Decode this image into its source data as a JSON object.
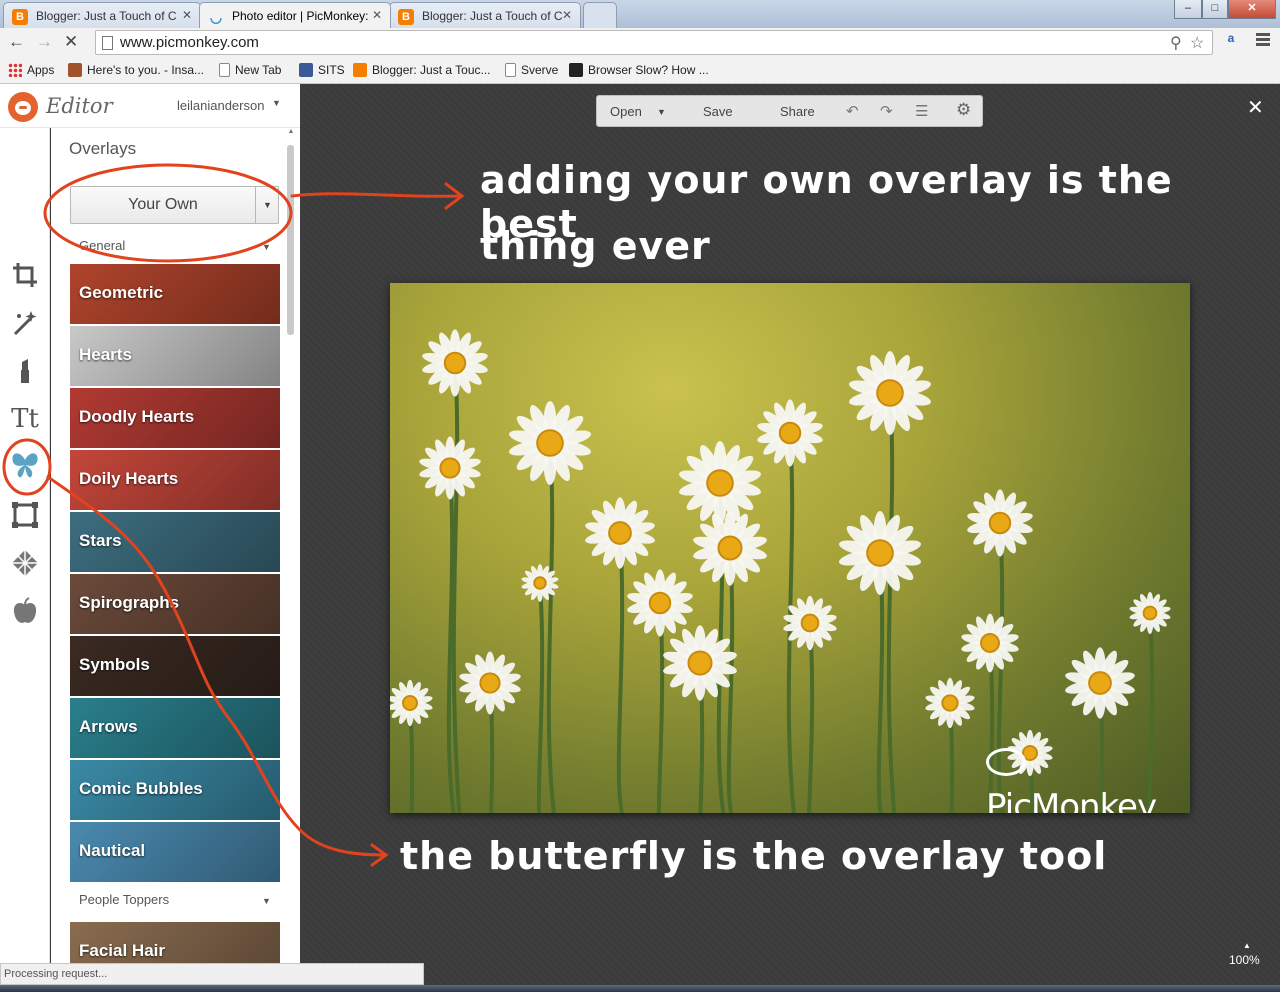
{
  "browser": {
    "tabs": [
      {
        "title": "Blogger: Just a Touch of C",
        "active": false,
        "favicon": "blogger-icon"
      },
      {
        "title": "Photo editor | PicMonkey:",
        "active": true,
        "favicon": "picmonkey-icon"
      },
      {
        "title": "Blogger: Just a Touch of C",
        "active": false,
        "favicon": "blogger-icon"
      }
    ],
    "window_controls": {
      "minimize": "–",
      "restore": "□",
      "close": "✕"
    },
    "url": "www.picmonkey.com",
    "bookmarks": [
      {
        "label": "Apps",
        "icon": "apps-grid-icon"
      },
      {
        "label": "Here's to you. - Insa...",
        "icon": "photo-favicon"
      },
      {
        "label": "New Tab",
        "icon": "page-icon"
      },
      {
        "label": "SITS",
        "icon": "facebook-icon"
      },
      {
        "label": "Blogger: Just a Touc...",
        "icon": "blogger-icon"
      },
      {
        "label": "Sverve",
        "icon": "page-icon"
      },
      {
        "label": "Browser Slow? How ...",
        "icon": "htg-icon"
      }
    ],
    "status_text": "Processing request..."
  },
  "editor": {
    "logo_text": "Editor",
    "username": "leilanianderson"
  },
  "panel": {
    "title": "Overlays",
    "your_own_button": "Your Own",
    "section_general": "General",
    "section_people": "People Toppers",
    "overlays": [
      {
        "label": "Geometric",
        "color": "#b0442c"
      },
      {
        "label": "Hearts",
        "color": "#c9c9c9"
      },
      {
        "label": "Doodly Hearts",
        "color": "#b23a33"
      },
      {
        "label": "Doily Hearts",
        "color": "#c4463a"
      },
      {
        "label": "Stars",
        "color": "#3d6e80"
      },
      {
        "label": "Spirographs",
        "color": "#6b4a3a"
      },
      {
        "label": "Symbols",
        "color": "#3a2a22"
      },
      {
        "label": "Arrows",
        "color": "#2a7f8c"
      },
      {
        "label": "Comic Bubbles",
        "color": "#3a8aa6"
      },
      {
        "label": "Nautical",
        "color": "#4a8ab0"
      }
    ],
    "people_overlays": [
      {
        "label": "Facial Hair",
        "color": "#8a6c50"
      }
    ]
  },
  "canvas_toolbar": {
    "open": "Open",
    "save": "Save",
    "share": "Share"
  },
  "canvas": {
    "zoom": "100%",
    "watermark": "PicMonkey"
  },
  "annotations": {
    "top_line1": "adding your own overlay is the best",
    "top_line2": "thing ever",
    "bottom": "the butterfly is the overlay tool",
    "color": "#e0431d"
  }
}
